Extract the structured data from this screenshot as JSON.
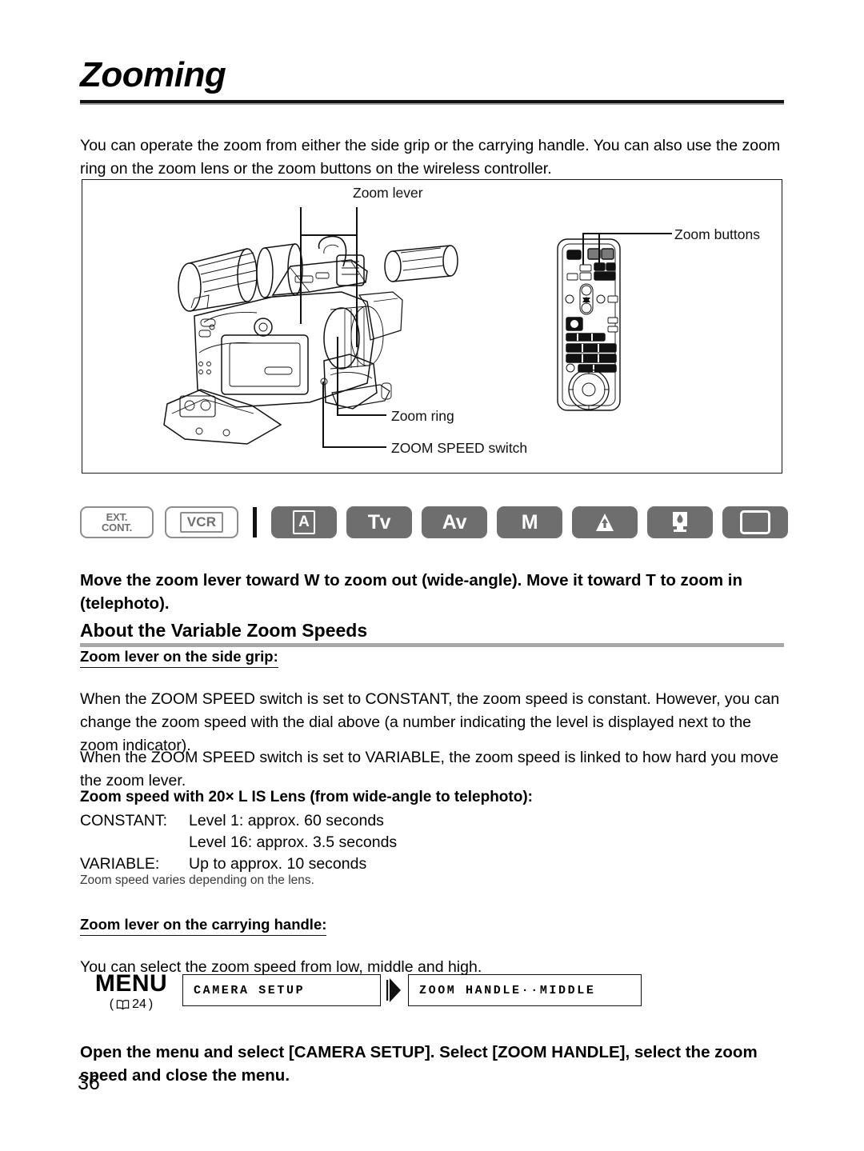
{
  "page": {
    "title": "Zooming",
    "number": "36"
  },
  "intro": "You can operate the zoom from either the side grip or the carrying handle. You can also use the zoom ring on the zoom lens or the zoom buttons on the wireless controller.",
  "figure": {
    "labels": {
      "zoom_lever": "Zoom lever",
      "zoom_buttons": "Zoom buttons",
      "zoom_ring": "Zoom ring",
      "zoom_speed_switch": "ZOOM SPEED switch"
    }
  },
  "mode_badges": [
    {
      "name": "ext-cont",
      "line1": "EXT.",
      "line2": "CONT.",
      "style": "outline"
    },
    {
      "name": "vcr",
      "label": "VCR",
      "style": "outline"
    },
    {
      "name": "auto",
      "label": "A",
      "style": "filled"
    },
    {
      "name": "tv",
      "label": "Tv",
      "style": "filled"
    },
    {
      "name": "av",
      "label": "Av",
      "style": "filled"
    },
    {
      "name": "manual",
      "label": "M",
      "style": "filled"
    },
    {
      "name": "spotlight",
      "label": "",
      "style": "filled"
    },
    {
      "name": "night",
      "label": "",
      "style": "filled"
    },
    {
      "name": "simple",
      "label": "",
      "style": "filled"
    }
  ],
  "instruction_1": "Move the zoom lever toward W to zoom out (wide-angle). Move it toward T to zoom in (telephoto).",
  "section": {
    "heading": "About the Variable Zoom Speeds",
    "side_grip": {
      "subhead": "Zoom lever on the side grip:",
      "para1": "When the ZOOM SPEED switch is set to CONSTANT, the zoom speed is constant. However, you can change the zoom speed with the dial above (a number indicating the level is displayed next to the zoom indicator).",
      "para2": "When the ZOOM SPEED switch is set to VARIABLE, the zoom speed is linked to how hard you move the zoom lever."
    },
    "spec": {
      "heading": "Zoom speed with 20× L IS Lens (from wide-angle to telephoto):",
      "rows": [
        {
          "key": "CONSTANT:",
          "value": "Level 1: approx. 60 seconds"
        },
        {
          "key": "",
          "value": "Level 16: approx. 3.5 seconds"
        },
        {
          "key": "VARIABLE:",
          "value": "Up to approx. 10 seconds"
        }
      ],
      "note": "Zoom speed varies depending on the lens."
    },
    "handle": {
      "subhead": "Zoom lever on the carrying handle:",
      "para": "You can select the zoom speed from low, middle and high."
    }
  },
  "menu": {
    "label": "MENU",
    "reference": "24",
    "box_1": "CAMERA SETUP",
    "box_2": "ZOOM HANDLE··MIDDLE"
  },
  "instruction_2": "Open the menu and select [CAMERA SETUP]. Select [ZOOM HANDLE], select the zoom speed and close the menu.",
  "colors": {
    "badge_fill": "#6e6e6e",
    "badge_outline": "#8d8d8d",
    "rule_gray": "#a8a8a8",
    "ink": "#111111"
  }
}
